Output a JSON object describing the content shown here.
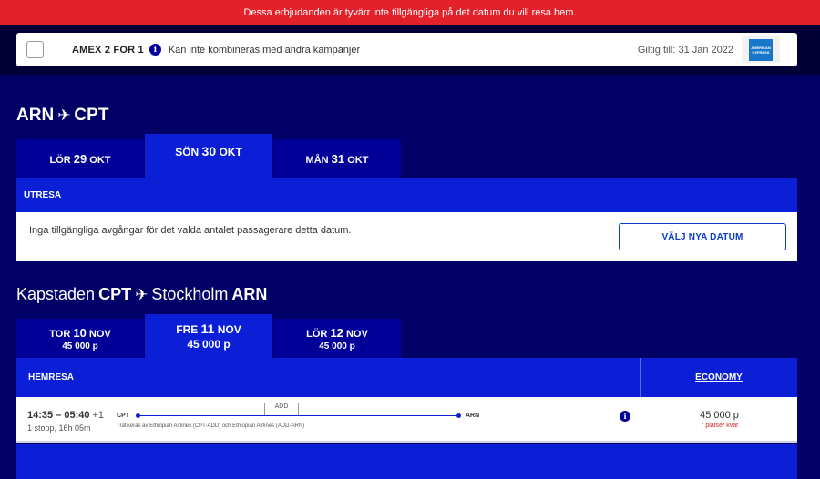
{
  "banner": {
    "text": "Dessa erbjudanden är tyvärr inte tillgängliga på det datum du vill resa hem."
  },
  "promo": {
    "title": "AMEX 2 FOR 1",
    "description": "Kan inte kombineras med andra kampanjer",
    "valid_until": "Giltig till: 31 Jan 2022",
    "card_logo_text": "AMERICAN EXPRESS"
  },
  "outbound": {
    "route_from": "ARN",
    "route_to": "CPT",
    "dates": [
      {
        "weekday": "LÖR",
        "day": "29",
        "month": "OKT",
        "selected": false
      },
      {
        "weekday": "SÖN",
        "day": "30",
        "month": "OKT",
        "selected": true
      },
      {
        "weekday": "MÅN",
        "day": "31",
        "month": "OKT",
        "selected": false
      }
    ],
    "section_label": "UTRESA",
    "no_results_message": "Inga tillgängliga avgångar för det valda antalet passagerare detta datum.",
    "new_dates_button": "VÄLJ NYA DATUM"
  },
  "return": {
    "from_city": "Kapstaden",
    "from_code": "CPT",
    "to_city": "Stockholm",
    "to_code": "ARN",
    "dates": [
      {
        "weekday": "TOR",
        "day": "10",
        "month": "NOV",
        "price": "45 000 p",
        "selected": false
      },
      {
        "weekday": "FRE",
        "day": "11",
        "month": "NOV",
        "price": "45 000 p",
        "selected": true
      },
      {
        "weekday": "LÖR",
        "day": "12",
        "month": "NOV",
        "price": "45 000 p",
        "selected": false
      }
    ],
    "section_label": "HEMRESA",
    "cabin_label": "ECONOMY",
    "flight": {
      "times": "14:35 – 05:40",
      "day_offset": "+1",
      "stops": "1 stopp, 16h 05m",
      "origin": "CPT",
      "destination": "ARN",
      "via": "ADD",
      "operated_by": "Trafikeras av Ethiopian Airlines (CPT-ADD) och Ethiopian Airlines (ADD-ARN)",
      "price": "45 000 p",
      "seats_left": "7 platser kvar"
    }
  },
  "icons": {
    "plane": "plane-icon",
    "info": "info-icon",
    "checkbox": "checkbox"
  },
  "colors": {
    "banner": "#e3212b",
    "navy": "#000066",
    "blue": "#0a1fd6",
    "tab": "#000099"
  }
}
